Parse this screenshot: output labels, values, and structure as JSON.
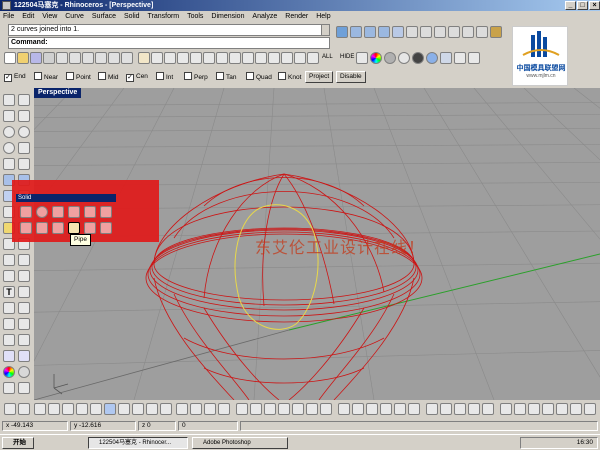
{
  "window": {
    "title": "122504马塞克 - Rhinoceros - [Perspective]",
    "controls": [
      "_",
      "□",
      "×"
    ]
  },
  "menu": [
    "File",
    "Edit",
    "View",
    "Curve",
    "Surface",
    "Solid",
    "Transform",
    "Tools",
    "Dimension",
    "Analyze",
    "Render",
    "Help"
  ],
  "command": {
    "history": "2 curves joined into 1.",
    "prompt": "Command:"
  },
  "toolbar_labels": {
    "all": "ALL",
    "hide": "HIDE"
  },
  "osnap": {
    "items": [
      {
        "label": "End",
        "checked": true
      },
      {
        "label": "Near",
        "checked": false
      },
      {
        "label": "Point",
        "checked": false
      },
      {
        "label": "Mid",
        "checked": false
      },
      {
        "label": "Cen",
        "checked": true
      },
      {
        "label": "Int",
        "checked": false
      },
      {
        "label": "Perp",
        "checked": false
      },
      {
        "label": "Tan",
        "checked": false
      },
      {
        "label": "Quad",
        "checked": false
      },
      {
        "label": "Knot",
        "checked": false
      }
    ],
    "project": "Project",
    "disable": "Disable"
  },
  "viewport": {
    "label": "Perspective",
    "overlay_text": "东艾伦工业设计在线！"
  },
  "solid_panel": {
    "title": "Solid",
    "tooltip": "Pipe"
  },
  "watermark": {
    "text": "中国模具联盟网",
    "url": "www.mjlm.cn"
  },
  "status": {
    "x": "x -49.143",
    "y": "y -12.616",
    "z": "z 0",
    "extra": "0"
  },
  "taskbar": {
    "start": "开始",
    "items": [
      "122504马塞克 - Rhinocer...",
      "Adobe Photoshop"
    ],
    "clock": "16:30"
  },
  "colors": {
    "title_active": "#0a246a",
    "curve_red": "#cc1515",
    "curve_yellow": "#e8d84a",
    "grid": "#8a8a8a",
    "axis_green": "#2aa02a"
  }
}
